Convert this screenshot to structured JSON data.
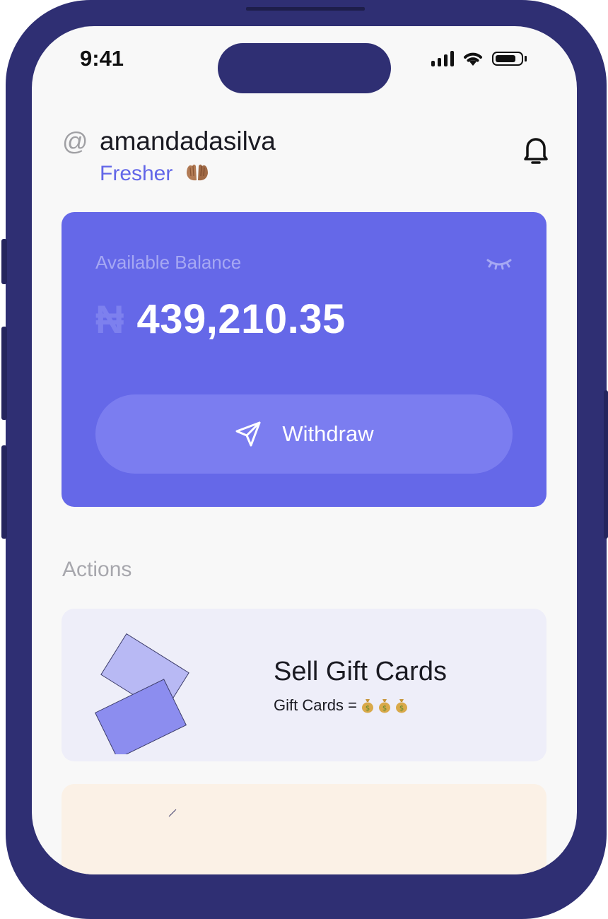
{
  "status_bar": {
    "time": "9:41",
    "icons": [
      "cellular-signal-icon",
      "wifi-icon",
      "battery-icon"
    ]
  },
  "header": {
    "at_symbol": "@",
    "username": "amandadasilva",
    "tier": "Fresher",
    "tier_emoji": "palms-up-together",
    "notification_icon": "bell-icon"
  },
  "balance_card": {
    "label": "Available Balance",
    "currency_symbol": "₦",
    "amount": "439,210.35",
    "visibility_icon": "eye-closed-icon",
    "withdraw_label": "Withdraw",
    "withdraw_icon": "send-icon"
  },
  "actions": {
    "title": "Actions",
    "items": [
      {
        "title": "Sell Gift Cards",
        "subtitle": "Gift Cards =",
        "subtitle_emojis": [
          "money-bag",
          "money-bag",
          "money-bag"
        ],
        "illustration": "gift-cards-illustration"
      }
    ]
  },
  "colors": {
    "frame": "#2f2f73",
    "accent": "#6568e8",
    "button": "#7b7df0",
    "card_light": "#eeeef9",
    "card_peach": "#fbf1e6"
  }
}
